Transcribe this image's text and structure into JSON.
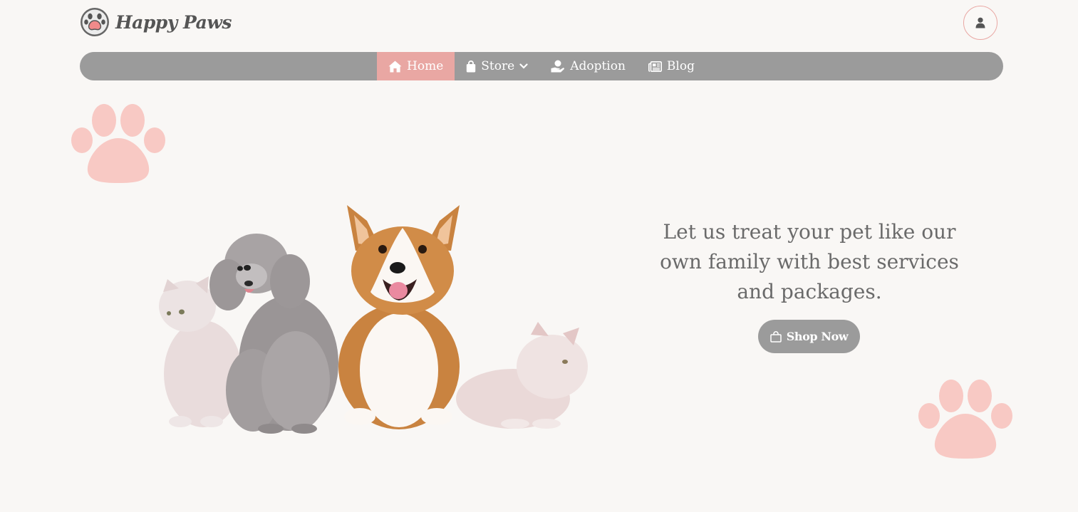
{
  "brand": {
    "name": "Happy Paws"
  },
  "header": {
    "user_icon": "user-icon"
  },
  "nav": {
    "items": [
      {
        "label": "Home",
        "icon": "home-icon",
        "active": true
      },
      {
        "label": "Store",
        "icon": "shopping-bag-icon",
        "dropdown": true
      },
      {
        "label": "Adoption",
        "icon": "hand-holding-heart-icon"
      },
      {
        "label": "Blog",
        "icon": "newspaper-icon"
      }
    ]
  },
  "hero": {
    "tagline": "Let us treat your pet like our own family with best services and packages.",
    "cta_label": "Shop Now",
    "cta_icon": "shopping-bag-icon",
    "image": "hero-pets-image"
  },
  "colors": {
    "accent": "#e9a7a3",
    "nav_bg": "#9b9b9b",
    "paw": "#f8c9c4",
    "page_bg": "#f9f7f5",
    "text": "#6a6a6a"
  }
}
